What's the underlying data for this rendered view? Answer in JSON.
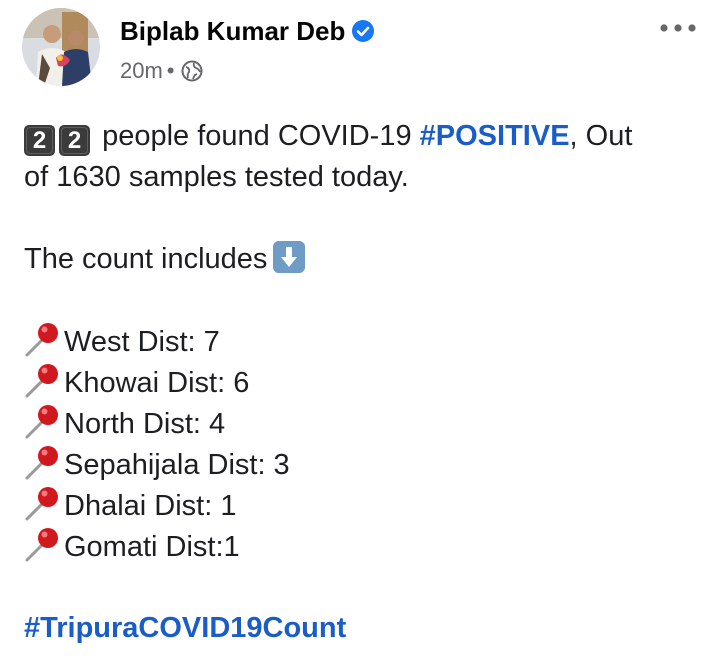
{
  "post": {
    "author": "Biplab Kumar Deb",
    "time": "20m",
    "separator": "•",
    "intro_numbers": [
      "2",
      "2"
    ],
    "intro_text_1": "people found COVID-19",
    "intro_hashtag": "#POSITIVE",
    "intro_text_2": ", Out",
    "intro_line_2": "of 1630 samples tested today.",
    "count_label": "The count includes",
    "districts": [
      "West Dist: 7",
      "Khowai Dist: 6",
      "North Dist: 4",
      "Sepahijala Dist: 3",
      "Dhalai Dist: 1",
      "Gomati Dist:1"
    ],
    "footer_hashtag": "#TripuraCOVID19Count"
  },
  "icons": {
    "verified": "verified-badge-icon",
    "privacy": "globe-icon",
    "more": "more-options-icon",
    "count_arrow": "down-arrow-emoji-icon",
    "pin": "round-pushpin-emoji-icon"
  },
  "colors": {
    "hashtag": "#1a5dc9",
    "verified": "#1877f2",
    "meta_text": "#65676b",
    "pin_head": "#d0191f"
  }
}
